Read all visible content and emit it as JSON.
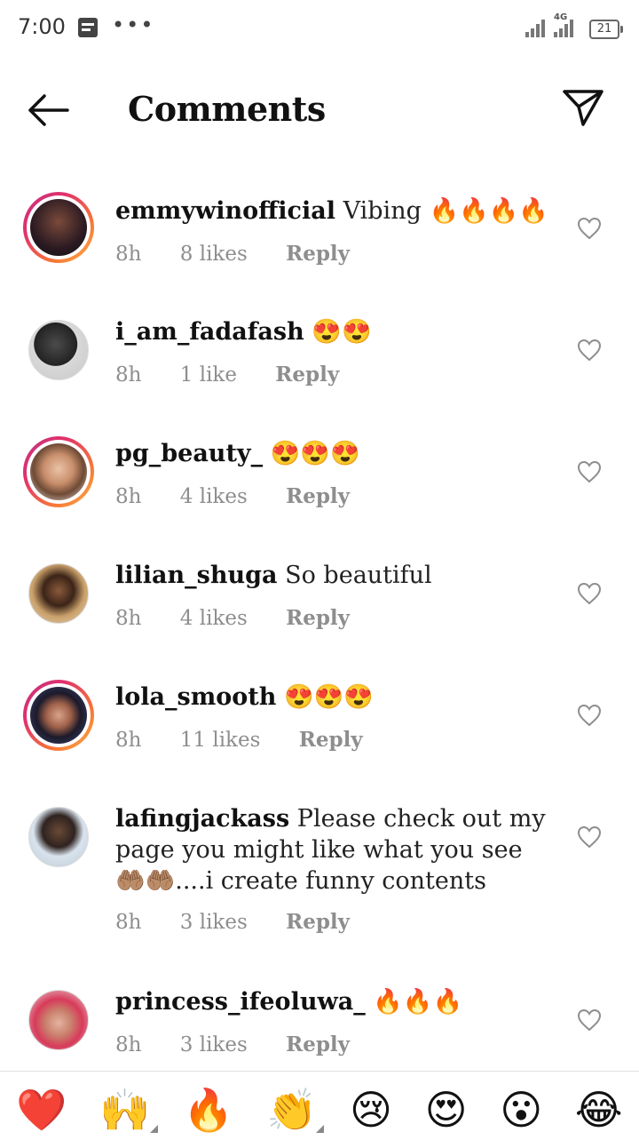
{
  "status_bar": {
    "time": "7:00",
    "network": "4G",
    "battery": "21"
  },
  "header": {
    "title": "Comments"
  },
  "comments": [
    {
      "username": "emmywinofficial",
      "text": "Vibing 🔥🔥🔥🔥",
      "time": "8h",
      "likes": "8 likes",
      "reply": "Reply",
      "story": true
    },
    {
      "username": "i_am_fadafash",
      "text": "😍😍",
      "time": "8h",
      "likes": "1 like",
      "reply": "Reply",
      "story": false
    },
    {
      "username": "pg_beauty_",
      "text": "😍😍😍",
      "time": "8h",
      "likes": "4 likes",
      "reply": "Reply",
      "story": true
    },
    {
      "username": "lilian_shuga",
      "text": "So beautiful",
      "time": "8h",
      "likes": "4 likes",
      "reply": "Reply",
      "story": false
    },
    {
      "username": "lola_smooth",
      "text": "😍😍😍",
      "time": "8h",
      "likes": "11 likes",
      "reply": "Reply",
      "story": true
    },
    {
      "username": "lafingjackass",
      "text": "Please check out my page you might like what you see 🤲🏽🤲🏽....i create funny contents",
      "time": "8h",
      "likes": "3 likes",
      "reply": "Reply",
      "story": false
    },
    {
      "username": "princess_ifeoluwa_",
      "text": "🔥🔥🔥",
      "time": "8h",
      "likes": "3 likes",
      "reply": "Reply",
      "story": false
    }
  ],
  "reactions": [
    "❤️",
    "🙌",
    "🔥",
    "👏",
    "😢",
    "😍",
    "😮",
    "😂"
  ],
  "colors": {
    "meta_gray": "#8e8e8e",
    "story_ring_start": "#c13584",
    "story_ring_end": "#fcaf45"
  }
}
